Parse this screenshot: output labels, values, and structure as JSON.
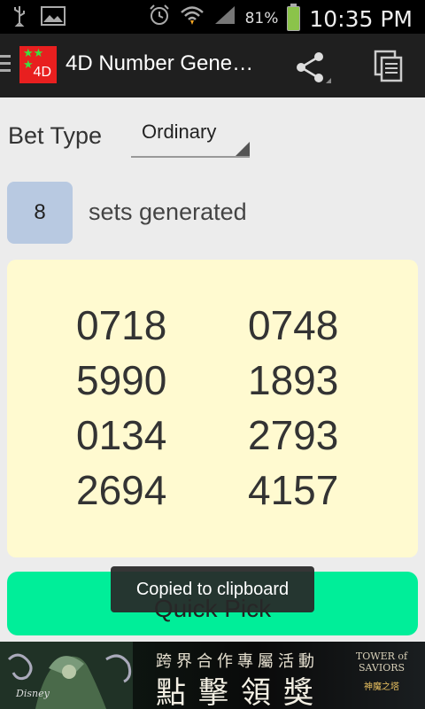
{
  "status_bar": {
    "battery_percent": "81%",
    "time": "10:35 PM",
    "icons": [
      "usb-icon",
      "image-icon",
      "alarm-icon",
      "wifi-icon",
      "signal-icon",
      "battery-icon"
    ]
  },
  "action_bar": {
    "app_icon_text": "4D",
    "title": "4D Number Gene…",
    "actions": [
      "share-icon",
      "copy-icon"
    ]
  },
  "bet_type": {
    "label": "Bet Type",
    "selected": "Ordinary"
  },
  "sets": {
    "count": "8",
    "label": "sets generated"
  },
  "results": {
    "numbers": [
      "0718",
      "0748",
      "5990",
      "1893",
      "0134",
      "2793",
      "2694",
      "4157"
    ]
  },
  "quick_pick": {
    "label": "Quick Pick"
  },
  "toast": {
    "message": "Copied to clipboard"
  },
  "ad": {
    "line1": "跨界合作專屬活動",
    "line2": "點擊領獎",
    "logo_text": "TOWER of SAVIORS",
    "logo_sub": "神魔之塔",
    "brand": "Disney"
  },
  "colors": {
    "action_bar": "#1f1f1f",
    "results_bg": "#fffad0",
    "quick_pick_bg": "#00ee99",
    "count_box_bg": "#b8c9e1"
  }
}
